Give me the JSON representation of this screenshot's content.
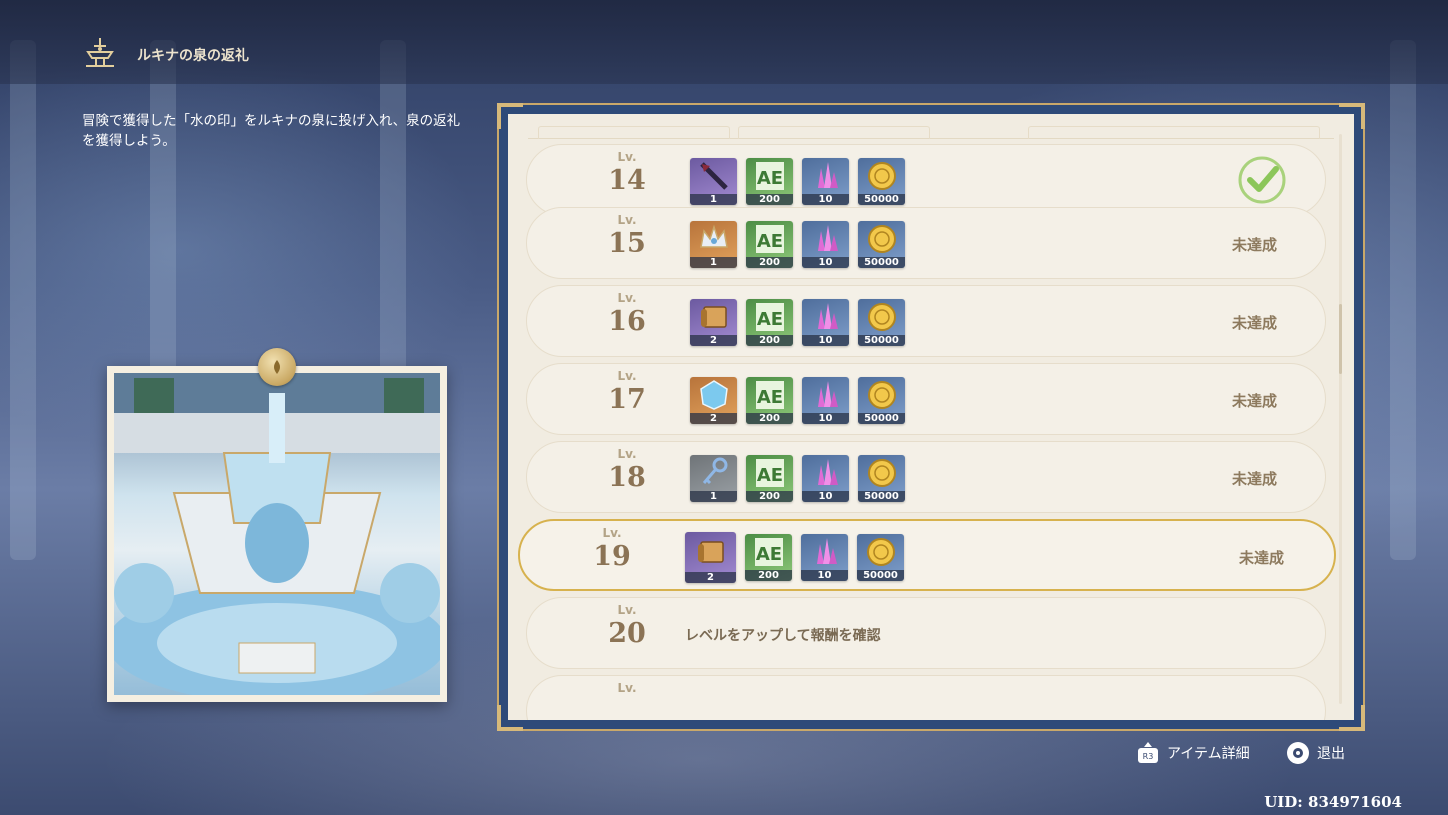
{
  "header": {
    "title": "ルキナの泉の返礼",
    "icon": "fountain-emblem-icon"
  },
  "description": "冒険で獲得した「水の印」をルキナの泉に投げ入れ、泉の返礼を獲得しよう。",
  "levels": [
    {
      "lv_label": "Lv.",
      "level": "14",
      "status": "",
      "completed": true,
      "items": [
        {
          "icon": "weapon-polearm-icon",
          "rarity": "purple",
          "qty": "1"
        },
        {
          "icon": "adventure-exp-icon",
          "rarity": "green",
          "qty": "200"
        },
        {
          "icon": "crystal-icon",
          "rarity": "blue",
          "qty": "10"
        },
        {
          "icon": "mora-coin-icon",
          "rarity": "blue",
          "qty": "50000"
        }
      ]
    },
    {
      "lv_label": "Lv.",
      "level": "15",
      "status": "未達成",
      "completed": false,
      "items": [
        {
          "icon": "crown-icon",
          "rarity": "orange",
          "qty": "1"
        },
        {
          "icon": "adventure-exp-icon",
          "rarity": "green",
          "qty": "200"
        },
        {
          "icon": "crystal-icon",
          "rarity": "blue",
          "qty": "10"
        },
        {
          "icon": "mora-coin-icon",
          "rarity": "blue",
          "qty": "50000"
        }
      ]
    },
    {
      "lv_label": "Lv.",
      "level": "16",
      "status": "未達成",
      "completed": false,
      "items": [
        {
          "icon": "scroll-book-icon",
          "rarity": "purple",
          "qty": "2"
        },
        {
          "icon": "adventure-exp-icon",
          "rarity": "green",
          "qty": "200"
        },
        {
          "icon": "crystal-icon",
          "rarity": "blue",
          "qty": "10"
        },
        {
          "icon": "mora-coin-icon",
          "rarity": "blue",
          "qty": "50000"
        }
      ]
    },
    {
      "lv_label": "Lv.",
      "level": "17",
      "status": "未達成",
      "completed": false,
      "items": [
        {
          "icon": "blue-ore-icon",
          "rarity": "orange",
          "qty": "2"
        },
        {
          "icon": "adventure-exp-icon",
          "rarity": "green",
          "qty": "200"
        },
        {
          "icon": "crystal-icon",
          "rarity": "blue",
          "qty": "10"
        },
        {
          "icon": "mora-coin-icon",
          "rarity": "blue",
          "qty": "50000"
        }
      ]
    },
    {
      "lv_label": "Lv.",
      "level": "18",
      "status": "未達成",
      "completed": false,
      "items": [
        {
          "icon": "key-icon",
          "rarity": "gray",
          "qty": "1"
        },
        {
          "icon": "adventure-exp-icon",
          "rarity": "green",
          "qty": "200"
        },
        {
          "icon": "crystal-icon",
          "rarity": "blue",
          "qty": "10"
        },
        {
          "icon": "mora-coin-icon",
          "rarity": "blue",
          "qty": "50000"
        }
      ]
    },
    {
      "lv_label": "Lv.",
      "level": "19",
      "status": "未達成",
      "completed": false,
      "selected": true,
      "items": [
        {
          "icon": "scroll-book-icon",
          "rarity": "purple",
          "qty": "2"
        },
        {
          "icon": "adventure-exp-icon",
          "rarity": "green",
          "qty": "200"
        },
        {
          "icon": "crystal-icon",
          "rarity": "blue",
          "qty": "10"
        },
        {
          "icon": "mora-coin-icon",
          "rarity": "blue",
          "qty": "50000"
        }
      ]
    },
    {
      "lv_label": "Lv.",
      "level": "20",
      "locked_text": "レベルをアップして報酬を確認"
    },
    {
      "lv_label": "Lv.",
      "level": ""
    }
  ],
  "footer": {
    "item_detail_label": "アイテム詳細",
    "item_detail_button": "R3",
    "exit_label": "退出",
    "uid": "UID: 834971604"
  },
  "colors": {
    "accent_gold": "#d7b24e",
    "panel_border": "#2e4a79",
    "row_bg": "#f4f0e7",
    "status_text": "#8d7a5e"
  }
}
